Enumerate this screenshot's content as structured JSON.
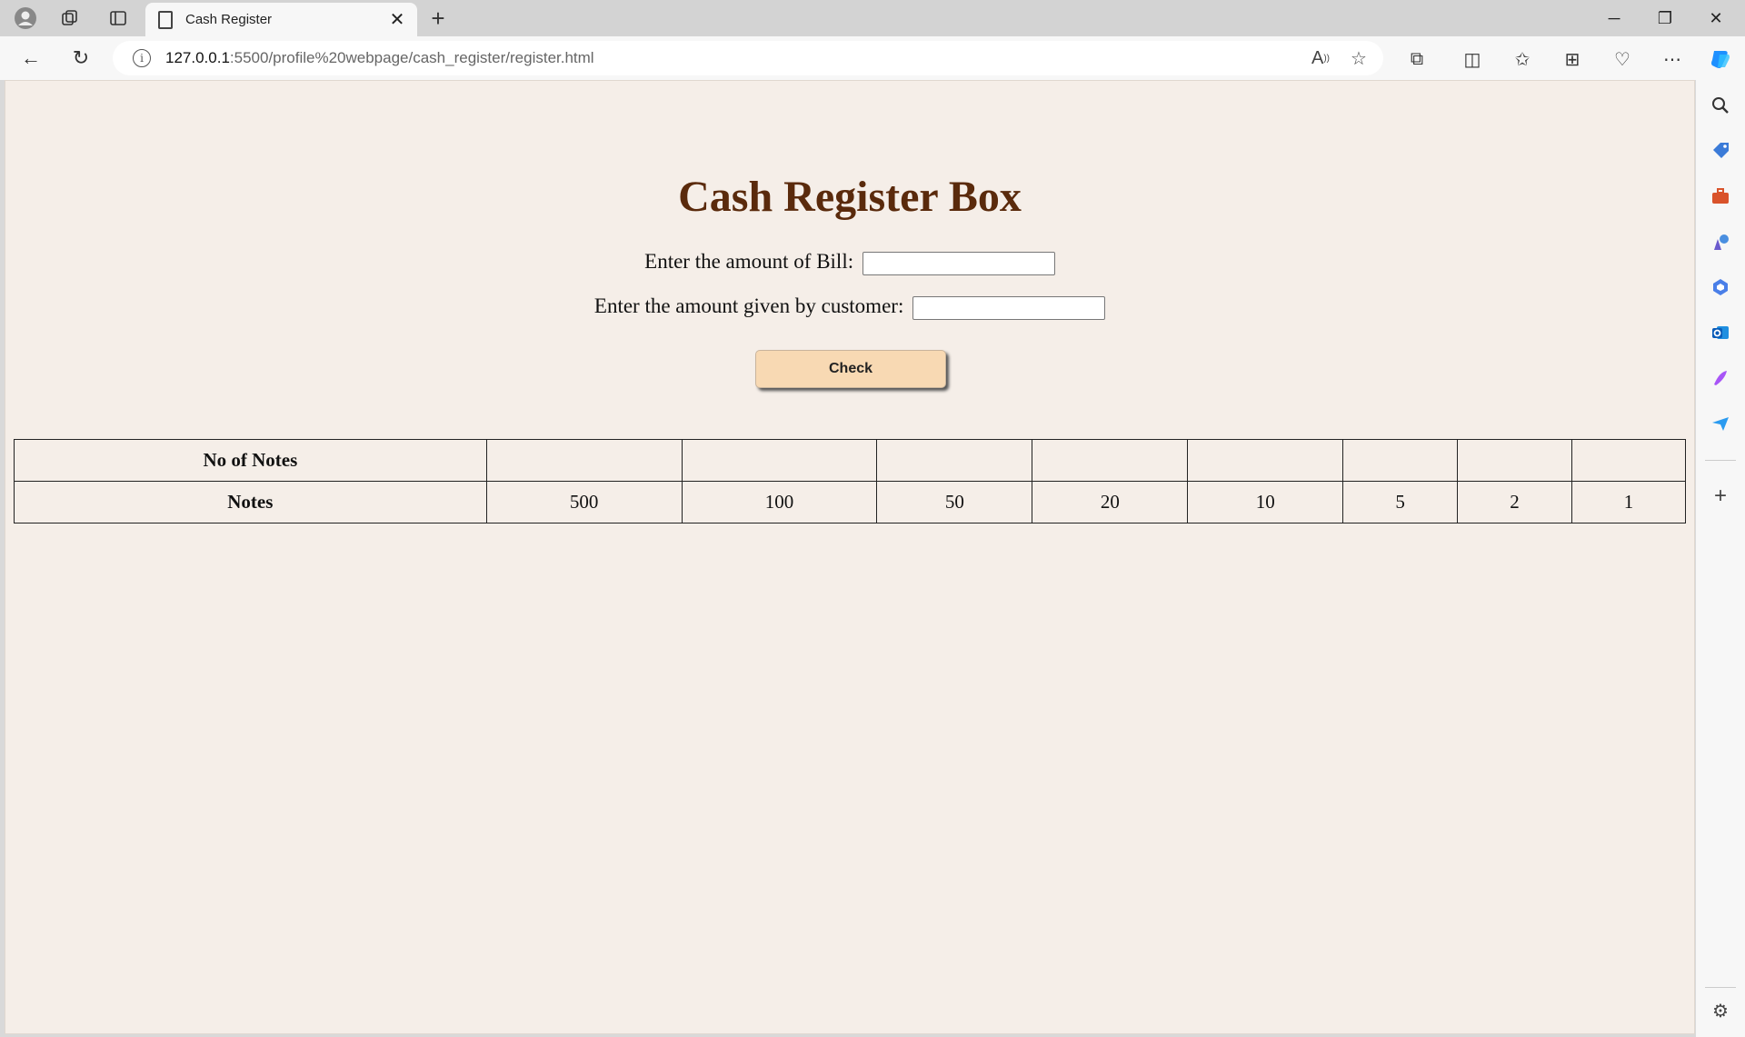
{
  "browser": {
    "tab_title": "Cash Register",
    "url_host": "127.0.0.1",
    "url_rest": ":5500/profile%20webpage/cash_register/register.html"
  },
  "page": {
    "title": "Cash Register Box",
    "bill_label": "Enter the amount of Bill:",
    "given_label": "Enter the amount given by customer:",
    "bill_value": "",
    "given_value": "",
    "check_label": "Check"
  },
  "table": {
    "row1_header": "No of Notes",
    "row2_header": "Notes",
    "no_of_notes": [
      "",
      "",
      "",
      "",
      "",
      "",
      "",
      ""
    ],
    "notes": [
      "500",
      "100",
      "50",
      "20",
      "10",
      "5",
      "2",
      "1"
    ]
  },
  "colors": {
    "page_background": "#f5eee8",
    "title_color": "#5a2a0c",
    "button_background": "#f8d9b3"
  }
}
